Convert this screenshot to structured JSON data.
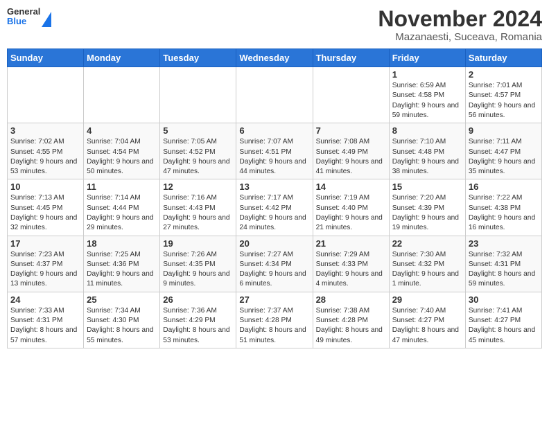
{
  "header": {
    "logo": {
      "general": "General",
      "blue": "Blue"
    },
    "title": "November 2024",
    "location": "Mazanaesti, Suceava, Romania"
  },
  "calendar": {
    "days_of_week": [
      "Sunday",
      "Monday",
      "Tuesday",
      "Wednesday",
      "Thursday",
      "Friday",
      "Saturday"
    ],
    "weeks": [
      [
        {
          "day": "",
          "info": ""
        },
        {
          "day": "",
          "info": ""
        },
        {
          "day": "",
          "info": ""
        },
        {
          "day": "",
          "info": ""
        },
        {
          "day": "",
          "info": ""
        },
        {
          "day": "1",
          "info": "Sunrise: 6:59 AM\nSunset: 4:58 PM\nDaylight: 9 hours and 59 minutes."
        },
        {
          "day": "2",
          "info": "Sunrise: 7:01 AM\nSunset: 4:57 PM\nDaylight: 9 hours and 56 minutes."
        }
      ],
      [
        {
          "day": "3",
          "info": "Sunrise: 7:02 AM\nSunset: 4:55 PM\nDaylight: 9 hours and 53 minutes."
        },
        {
          "day": "4",
          "info": "Sunrise: 7:04 AM\nSunset: 4:54 PM\nDaylight: 9 hours and 50 minutes."
        },
        {
          "day": "5",
          "info": "Sunrise: 7:05 AM\nSunset: 4:52 PM\nDaylight: 9 hours and 47 minutes."
        },
        {
          "day": "6",
          "info": "Sunrise: 7:07 AM\nSunset: 4:51 PM\nDaylight: 9 hours and 44 minutes."
        },
        {
          "day": "7",
          "info": "Sunrise: 7:08 AM\nSunset: 4:49 PM\nDaylight: 9 hours and 41 minutes."
        },
        {
          "day": "8",
          "info": "Sunrise: 7:10 AM\nSunset: 4:48 PM\nDaylight: 9 hours and 38 minutes."
        },
        {
          "day": "9",
          "info": "Sunrise: 7:11 AM\nSunset: 4:47 PM\nDaylight: 9 hours and 35 minutes."
        }
      ],
      [
        {
          "day": "10",
          "info": "Sunrise: 7:13 AM\nSunset: 4:45 PM\nDaylight: 9 hours and 32 minutes."
        },
        {
          "day": "11",
          "info": "Sunrise: 7:14 AM\nSunset: 4:44 PM\nDaylight: 9 hours and 29 minutes."
        },
        {
          "day": "12",
          "info": "Sunrise: 7:16 AM\nSunset: 4:43 PM\nDaylight: 9 hours and 27 minutes."
        },
        {
          "day": "13",
          "info": "Sunrise: 7:17 AM\nSunset: 4:42 PM\nDaylight: 9 hours and 24 minutes."
        },
        {
          "day": "14",
          "info": "Sunrise: 7:19 AM\nSunset: 4:40 PM\nDaylight: 9 hours and 21 minutes."
        },
        {
          "day": "15",
          "info": "Sunrise: 7:20 AM\nSunset: 4:39 PM\nDaylight: 9 hours and 19 minutes."
        },
        {
          "day": "16",
          "info": "Sunrise: 7:22 AM\nSunset: 4:38 PM\nDaylight: 9 hours and 16 minutes."
        }
      ],
      [
        {
          "day": "17",
          "info": "Sunrise: 7:23 AM\nSunset: 4:37 PM\nDaylight: 9 hours and 13 minutes."
        },
        {
          "day": "18",
          "info": "Sunrise: 7:25 AM\nSunset: 4:36 PM\nDaylight: 9 hours and 11 minutes."
        },
        {
          "day": "19",
          "info": "Sunrise: 7:26 AM\nSunset: 4:35 PM\nDaylight: 9 hours and 9 minutes."
        },
        {
          "day": "20",
          "info": "Sunrise: 7:27 AM\nSunset: 4:34 PM\nDaylight: 9 hours and 6 minutes."
        },
        {
          "day": "21",
          "info": "Sunrise: 7:29 AM\nSunset: 4:33 PM\nDaylight: 9 hours and 4 minutes."
        },
        {
          "day": "22",
          "info": "Sunrise: 7:30 AM\nSunset: 4:32 PM\nDaylight: 9 hours and 1 minute."
        },
        {
          "day": "23",
          "info": "Sunrise: 7:32 AM\nSunset: 4:31 PM\nDaylight: 8 hours and 59 minutes."
        }
      ],
      [
        {
          "day": "24",
          "info": "Sunrise: 7:33 AM\nSunset: 4:31 PM\nDaylight: 8 hours and 57 minutes."
        },
        {
          "day": "25",
          "info": "Sunrise: 7:34 AM\nSunset: 4:30 PM\nDaylight: 8 hours and 55 minutes."
        },
        {
          "day": "26",
          "info": "Sunrise: 7:36 AM\nSunset: 4:29 PM\nDaylight: 8 hours and 53 minutes."
        },
        {
          "day": "27",
          "info": "Sunrise: 7:37 AM\nSunset: 4:28 PM\nDaylight: 8 hours and 51 minutes."
        },
        {
          "day": "28",
          "info": "Sunrise: 7:38 AM\nSunset: 4:28 PM\nDaylight: 8 hours and 49 minutes."
        },
        {
          "day": "29",
          "info": "Sunrise: 7:40 AM\nSunset: 4:27 PM\nDaylight: 8 hours and 47 minutes."
        },
        {
          "day": "30",
          "info": "Sunrise: 7:41 AM\nSunset: 4:27 PM\nDaylight: 8 hours and 45 minutes."
        }
      ]
    ]
  }
}
